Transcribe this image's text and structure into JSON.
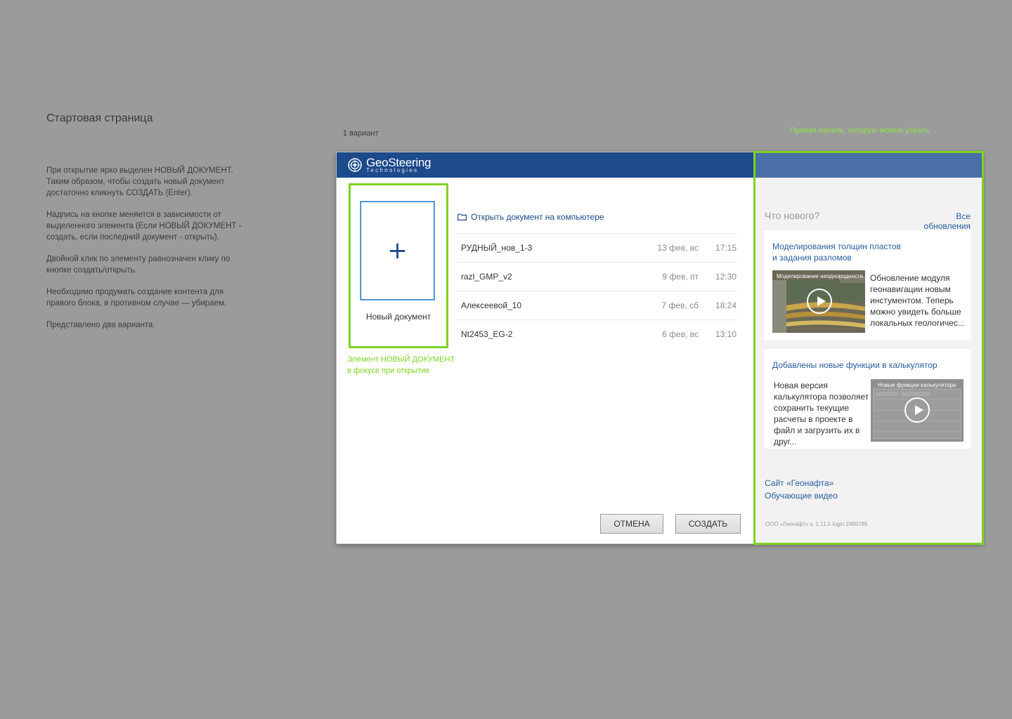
{
  "page": {
    "title": "Стартовая страница",
    "variant_label": "1 вариант",
    "notes": [
      "При открытие ярко выделен НОВЫЙ ДОКУМЕНТ. Таким образом, чтобы создать новый документ достаточно кликнуть СОЗДАТЬ (Enter).",
      "Надпись на кнопке меняется в зависимости от выделенного элемента (Если НОВЫЙ ДОКУМЕНТ - создать, если последний документ - открыть).",
      "Двойной клик по элементу равнозначен клику по кнопке создать/открыть.",
      "Необходимо продумать создание контента для правого блока, в противном случае — убираем.",
      "Представлено два варианта."
    ],
    "annotation_right_panel": "Правая панель, которую можно убрать",
    "annotation_new_doc_line1": "Элемент НОВЫЙ ДОКУМЕНТ",
    "annotation_new_doc_line2": "в фокусе при открытие"
  },
  "window": {
    "logo_main": "GeoSteering",
    "logo_sub": "Technologies",
    "new_document_label": "Новый документ",
    "open_on_computer": "Открыть документ на компьютере",
    "recent": [
      {
        "name": "РУДНЫЙ_нов_1-3",
        "date": "13 фев, вс",
        "time": "17:15"
      },
      {
        "name": "razl_GMP_v2",
        "date": "9 фев, пт",
        "time": "12:30"
      },
      {
        "name": "Алексеевой_10",
        "date": "7 фев, сб",
        "time": "18:24"
      },
      {
        "name": "Nt2453_EG-2",
        "date": "6 фев, вс",
        "time": "13:10"
      }
    ],
    "cancel_label": "ОТМЕНА",
    "create_label": "СОЗДАТЬ"
  },
  "right_panel": {
    "whats_new": "Что нового?",
    "all_updates": "Все обновления",
    "news": [
      {
        "title_line1": "Моделирования толщин пластов",
        "title_line2": "и задания разломов",
        "thumb_caption": "Моделирование неоднородносте...",
        "text": "Обновление модуля геонавигации новым инстументом. Теперь можно увидеть больше локальных геологичес..."
      },
      {
        "title_line1": "Добавлены новые функции в калькулятор",
        "thumb_caption": "Новые функции калькулятора",
        "text": "Новая версия калькулятора позволяет сохранить текущие расчеты в проекте в файл и загрузить их в друг..."
      }
    ],
    "link_site": "Сайт «Геонафта»",
    "link_videos": "Обучающие видео",
    "footer": "ООО «Геонафт» v. 1.11.5 login 2495785"
  },
  "colors": {
    "header_blue": "#1c4a8a",
    "right_header_blue": "#4a6fa8",
    "annotation_green": "#7ed321",
    "link_blue": "#2a5d9f"
  }
}
